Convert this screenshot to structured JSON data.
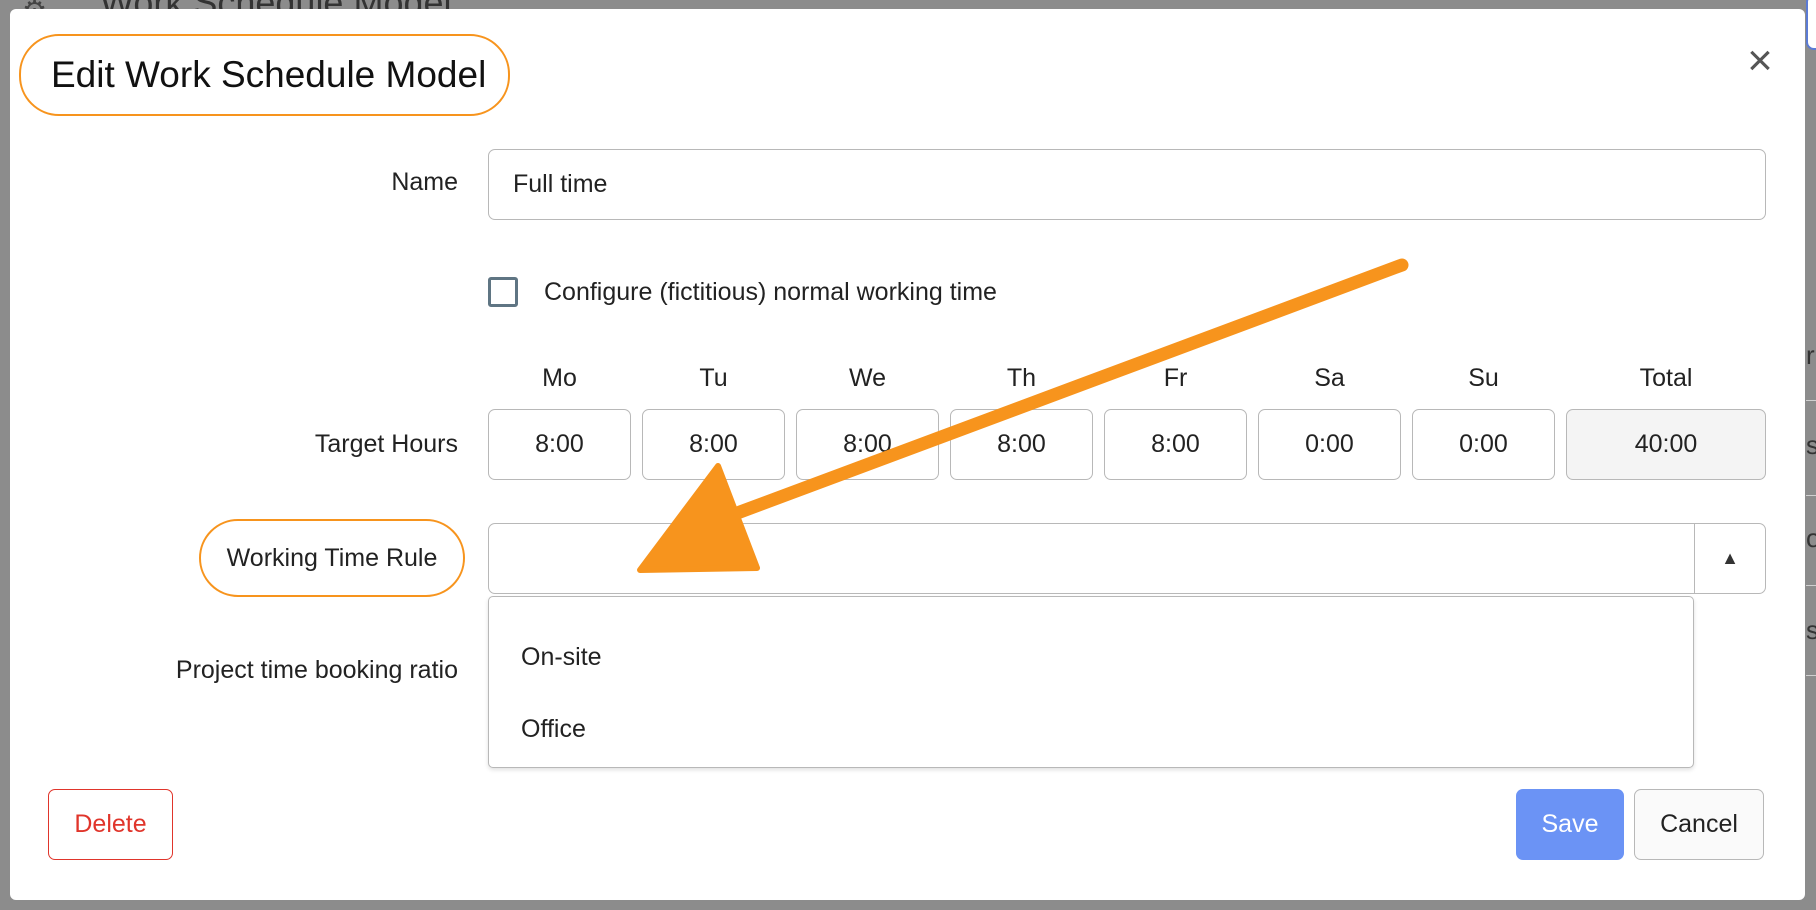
{
  "background": {
    "partial_title": "Work Schedule Model",
    "right_edge_chars": [
      "rl",
      "s",
      "o",
      "s"
    ]
  },
  "dialog": {
    "title": "Edit Work Schedule Model",
    "close_icon": "close-icon",
    "name_label": "Name",
    "name_value": "Full time",
    "checkbox_label": "Configure (fictitious) normal working time",
    "checkbox_checked": false,
    "target_hours_label": "Target Hours",
    "days": [
      {
        "head": "Mo",
        "value": "8:00"
      },
      {
        "head": "Tu",
        "value": "8:00"
      },
      {
        "head": "We",
        "value": "8:00"
      },
      {
        "head": "Th",
        "value": "8:00"
      },
      {
        "head": "Fr",
        "value": "8:00"
      },
      {
        "head": "Sa",
        "value": "0:00"
      },
      {
        "head": "Su",
        "value": "0:00"
      }
    ],
    "total_head": "Total",
    "total_value": "40:00",
    "working_time_rule_label": "Working Time Rule",
    "working_time_rule_value": "",
    "dropdown_arrow_icon": "caret-up-icon",
    "dropdown_options": [
      "On-site",
      "Office"
    ],
    "project_ratio_label": "Project time booking ratio",
    "delete_label": "Delete",
    "save_label": "Save",
    "cancel_label": "Cancel"
  },
  "colors": {
    "highlight_orange": "#f7941d",
    "save_blue": "#6b93f5",
    "delete_red": "#e0352b"
  }
}
